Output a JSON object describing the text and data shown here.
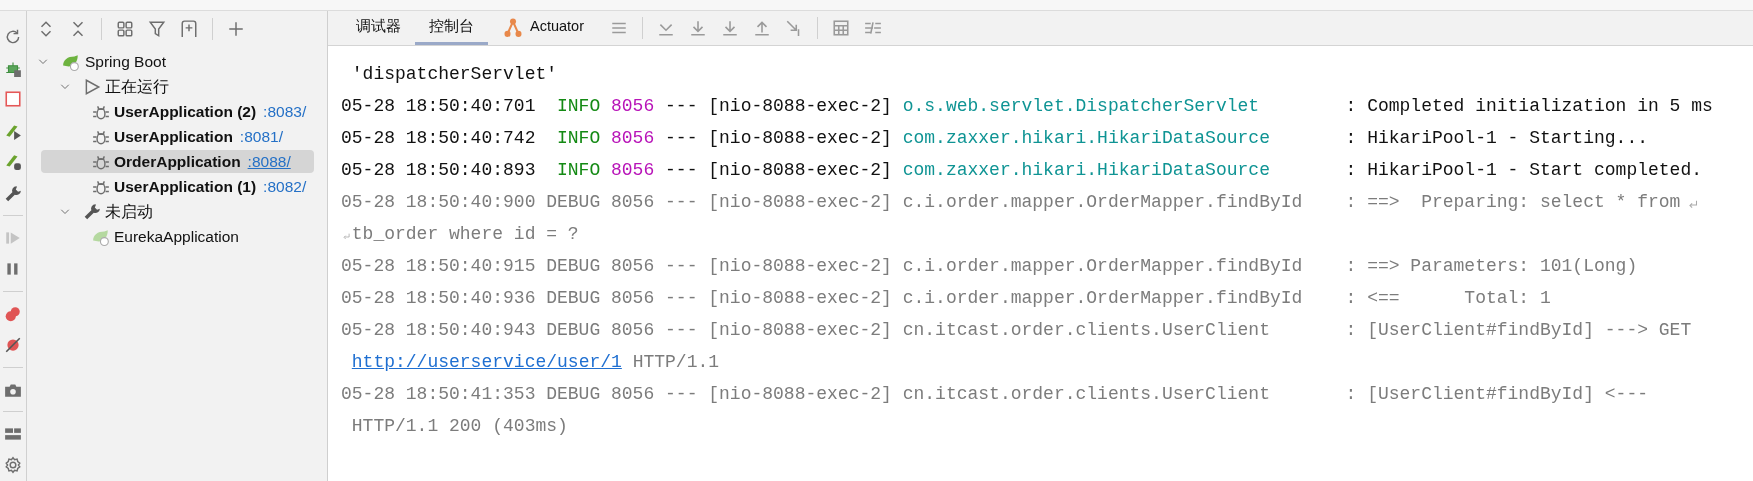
{
  "tree": [
    {
      "label": "Spring Boot",
      "kind": "root",
      "expanded": true,
      "children": [
        {
          "label": "正在运行",
          "kind": "running-group",
          "expanded": true,
          "children": [
            {
              "label": "UserApplication (2)",
              "kind": "app",
              "running": true,
              "port": ":8083/",
              "selected": false
            },
            {
              "label": "UserApplication",
              "kind": "app",
              "running": true,
              "port": ":8081/",
              "selected": false
            },
            {
              "label": "OrderApplication",
              "kind": "app",
              "running": true,
              "port": ":8088/",
              "selected": true
            },
            {
              "label": "UserApplication (1)",
              "kind": "app",
              "running": true,
              "port": ":8082/",
              "selected": false
            }
          ]
        },
        {
          "label": "未启动",
          "kind": "stopped-group",
          "expanded": true,
          "children": [
            {
              "label": "EurekaApplication",
              "kind": "app",
              "running": false,
              "selected": false
            }
          ]
        }
      ]
    }
  ],
  "tabs": [
    {
      "label": "调试器",
      "kind": "plain",
      "selected": false
    },
    {
      "label": "控制台",
      "kind": "plain",
      "selected": true
    },
    {
      "label": "Actuator",
      "kind": "actuator",
      "selected": false
    }
  ],
  "log": [
    {
      "kind": "continuation",
      "text": "'dispatcherServlet'"
    },
    {
      "kind": "info",
      "time": "05-28 18:50:40:701",
      "level": "INFO",
      "pid": "8056",
      "dashes": "---",
      "thread": "[nio-8088-exec-2]",
      "logger": "o.s.web.servlet.DispatcherServlet",
      "colon": ":",
      "message": "Completed initialization in 5 ms",
      "soft_wrap": false
    },
    {
      "kind": "info",
      "time": "05-28 18:50:40:742",
      "level": "INFO",
      "pid": "8056",
      "dashes": "---",
      "thread": "[nio-8088-exec-2]",
      "logger": "com.zaxxer.hikari.HikariDataSource",
      "colon": ":",
      "message": "HikariPool-1 - Starting...",
      "soft_wrap": false
    },
    {
      "kind": "info",
      "time": "05-28 18:50:40:893",
      "level": "INFO",
      "pid": "8056",
      "dashes": "---",
      "thread": "[nio-8088-exec-2]",
      "logger": "com.zaxxer.hikari.HikariDataSource",
      "colon": ":",
      "message": "HikariPool-1 - Start completed.",
      "soft_wrap": false
    },
    {
      "kind": "debug",
      "time": "05-28 18:50:40:900",
      "level": "DEBUG",
      "pid": "8056",
      "dashes": "---",
      "thread": "[nio-8088-exec-2]",
      "logger": "c.i.order.mapper.OrderMapper.findById",
      "colon": ":",
      "message": "==>  Preparing: select * from",
      "soft_wrap": true,
      "wrap_text": "tb_order where id = ?"
    },
    {
      "kind": "debug",
      "time": "05-28 18:50:40:915",
      "level": "DEBUG",
      "pid": "8056",
      "dashes": "---",
      "thread": "[nio-8088-exec-2]",
      "logger": "c.i.order.mapper.OrderMapper.findById",
      "colon": ":",
      "message": "==> Parameters: 101(Long)",
      "soft_wrap": false
    },
    {
      "kind": "debug",
      "time": "05-28 18:50:40:936",
      "level": "DEBUG",
      "pid": "8056",
      "dashes": "---",
      "thread": "[nio-8088-exec-2]",
      "logger": "c.i.order.mapper.OrderMapper.findById",
      "colon": ":",
      "message": "<==      Total: 1",
      "soft_wrap": false
    },
    {
      "kind": "debug",
      "time": "05-28 18:50:40:943",
      "level": "DEBUG",
      "pid": "8056",
      "dashes": "---",
      "thread": "[nio-8088-exec-2]",
      "logger": "cn.itcast.order.clients.UserClient",
      "colon": ":",
      "message": "[UserClient#findById] ---> GET",
      "soft_wrap": false,
      "wrap_link": "http://userservice/user/1",
      "wrap_text": "HTTP/1.1"
    },
    {
      "kind": "debug",
      "time": "05-28 18:50:41:353",
      "level": "DEBUG",
      "pid": "8056",
      "dashes": "---",
      "thread": "[nio-8088-exec-2]",
      "logger": "cn.itcast.order.clients.UserClient",
      "colon": ":",
      "message": "[UserClient#findById] <---",
      "soft_wrap": false,
      "wrap_text": "HTTP/1.1 200 (403ms)"
    }
  ]
}
